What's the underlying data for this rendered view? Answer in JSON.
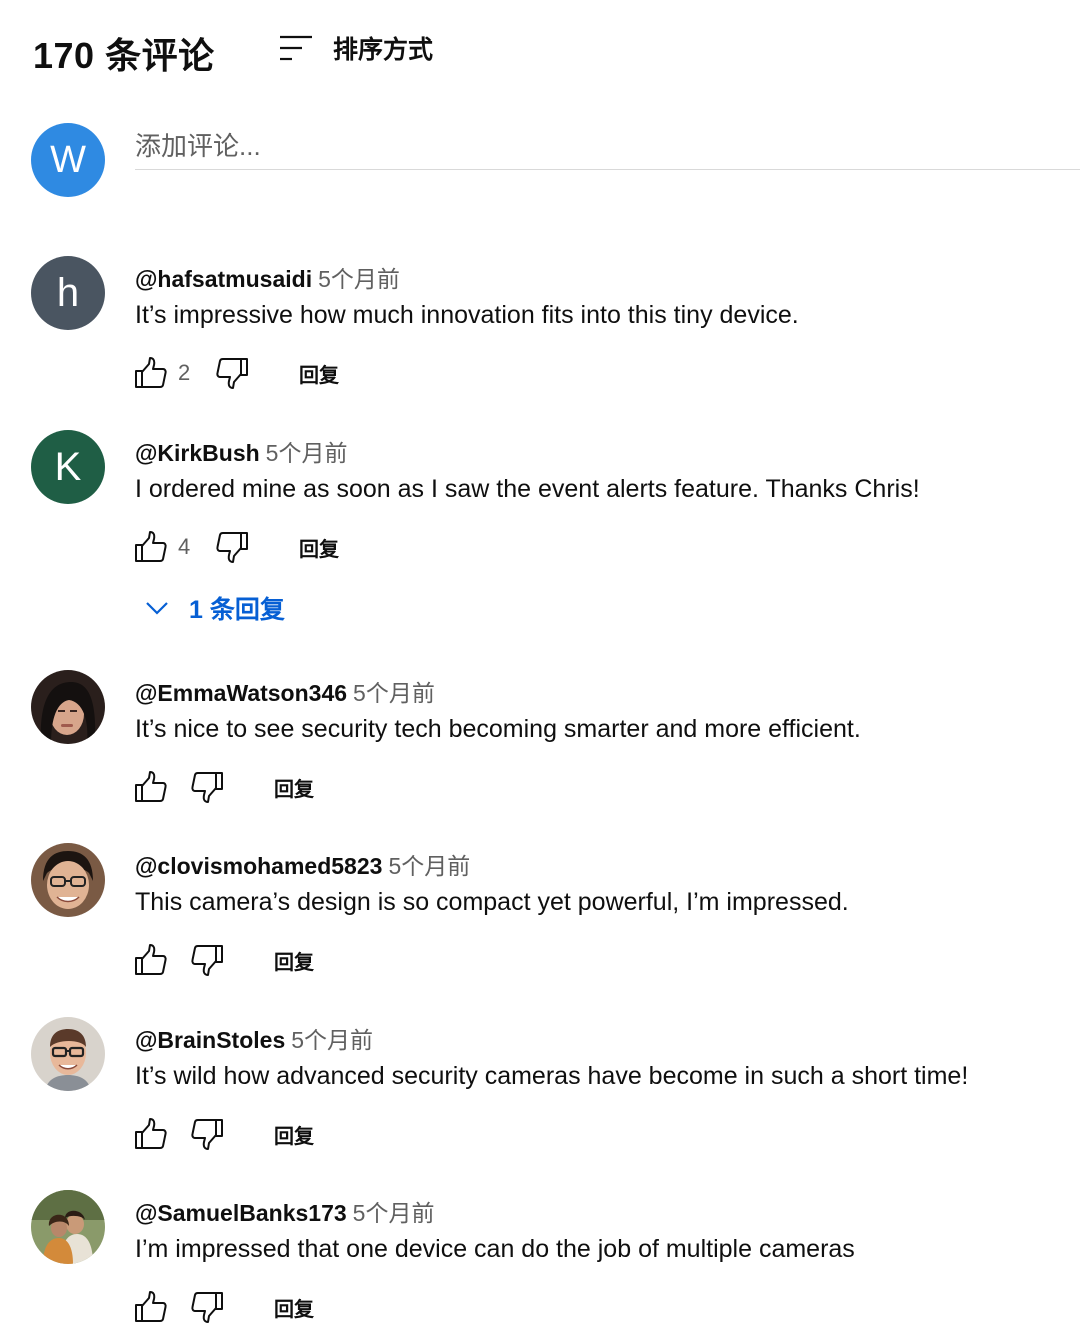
{
  "header": {
    "count_label": "170 条评论",
    "sort_label": "排序方式",
    "sort_icon": "sort-icon"
  },
  "add_comment": {
    "avatar_letter": "W",
    "avatar_color": "#2f8ae2",
    "placeholder": "添加评论..."
  },
  "reply_label": "回复",
  "comments": [
    {
      "author": "@hafsatmusaidi",
      "time": "5个月前",
      "text": "It’s impressive how much innovation fits into this tiny device.",
      "likes": "2",
      "avatar_letter": "h",
      "avatar_color": "#4a5561"
    },
    {
      "author": "@KirkBush",
      "time": "5个月前",
      "text": "I ordered mine as soon as I saw the event alerts feature. Thanks Chris!",
      "likes": "4",
      "avatar_letter": "K",
      "avatar_color": "#1f5e45",
      "replies_label": "1 条回复"
    },
    {
      "author": "@EmmaWatson346",
      "time": "5个月前",
      "text": "It’s nice to see security tech becoming smarter and more efficient.",
      "likes": "",
      "avatar_letter": "",
      "avatar_color": "#3b2b27"
    },
    {
      "author": "@clovismohamed5823",
      "time": "5个月前",
      "text": "This camera’s design is so compact yet powerful, I’m impressed.",
      "likes": "",
      "avatar_letter": "",
      "avatar_color": "#6b4a35"
    },
    {
      "author": "@BrainStoles",
      "time": "5个月前",
      "text": "It’s wild how advanced security cameras have become in such a short time!",
      "likes": "",
      "avatar_letter": "",
      "avatar_color": "#c9b7a6"
    },
    {
      "author": "@SamuelBanks173",
      "time": "5个月前",
      "text": "I’m impressed that one device can do the job of multiple cameras",
      "likes": "",
      "avatar_letter": "",
      "avatar_color": "#6f7a4a"
    }
  ]
}
